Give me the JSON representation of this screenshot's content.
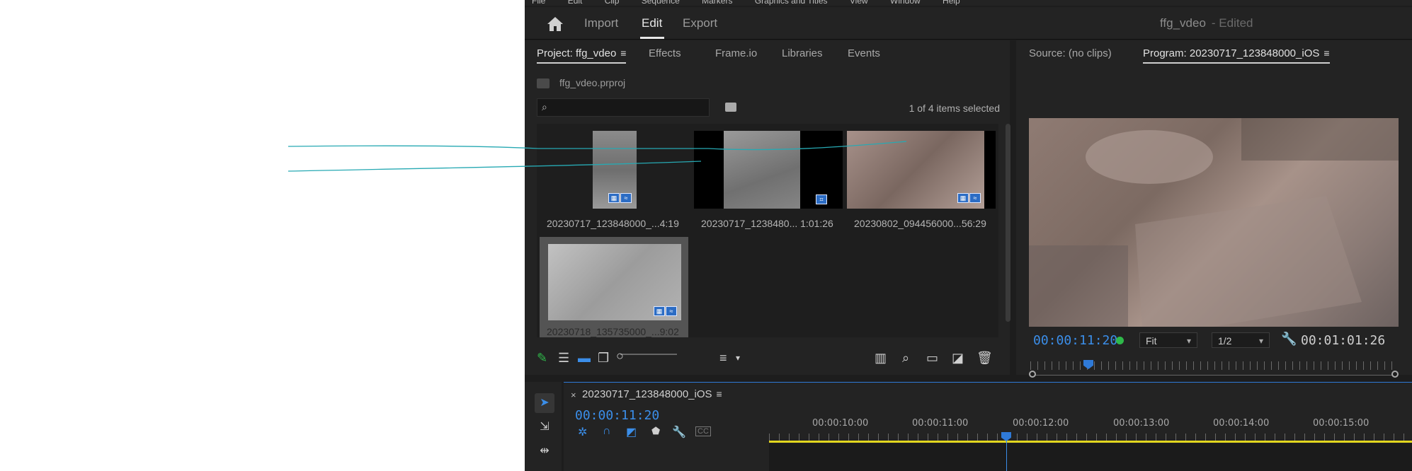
{
  "menubar": {
    "items": [
      "File",
      "Edit",
      "Clip",
      "Sequence",
      "Markers",
      "Graphics and Titles",
      "View",
      "Window",
      "Help"
    ]
  },
  "topbar": {
    "tabs": [
      "Import",
      "Edit",
      "Export"
    ],
    "active_tab": "Edit",
    "project_title": "ffg_vdeo",
    "edited_label": "- Edited"
  },
  "project_panel": {
    "tabs": [
      "Project: ffg_vdeo",
      "Effects",
      "Frame.io",
      "Libraries",
      "Events"
    ],
    "project_file": "ffg_vdeo.prproj",
    "search_placeholder": "",
    "count_text": "1 of 4 items selected",
    "clips": [
      {
        "name": "20230717_123848000_...4:19"
      },
      {
        "name": "20230717_1238480... 1:01:26"
      },
      {
        "name": "20230802_094456000...56:29"
      },
      {
        "name": "20230718_135735000_...9:02"
      }
    ]
  },
  "program_panel": {
    "tabs": [
      "Source: (no clips)",
      "Program: 20230717_123848000_iOS"
    ],
    "timecode_current": "00:00:11:20",
    "timecode_duration": "00:01:01:26",
    "fit_select": "Fit",
    "resolution_select": "1/2"
  },
  "timeline": {
    "sequence_name": "20230717_123848000_iOS",
    "timecode": "00:00:11:20",
    "time_labels": [
      "00:00:10:00",
      "00:00:11:00",
      "00:00:12:00",
      "00:00:13:00",
      "00:00:14:00",
      "00:00:15:00"
    ]
  },
  "colors": {
    "accent_blue": "#3b8ee9",
    "playhead_yellow": "#e2d61e",
    "status_green": "#2fb94a"
  }
}
